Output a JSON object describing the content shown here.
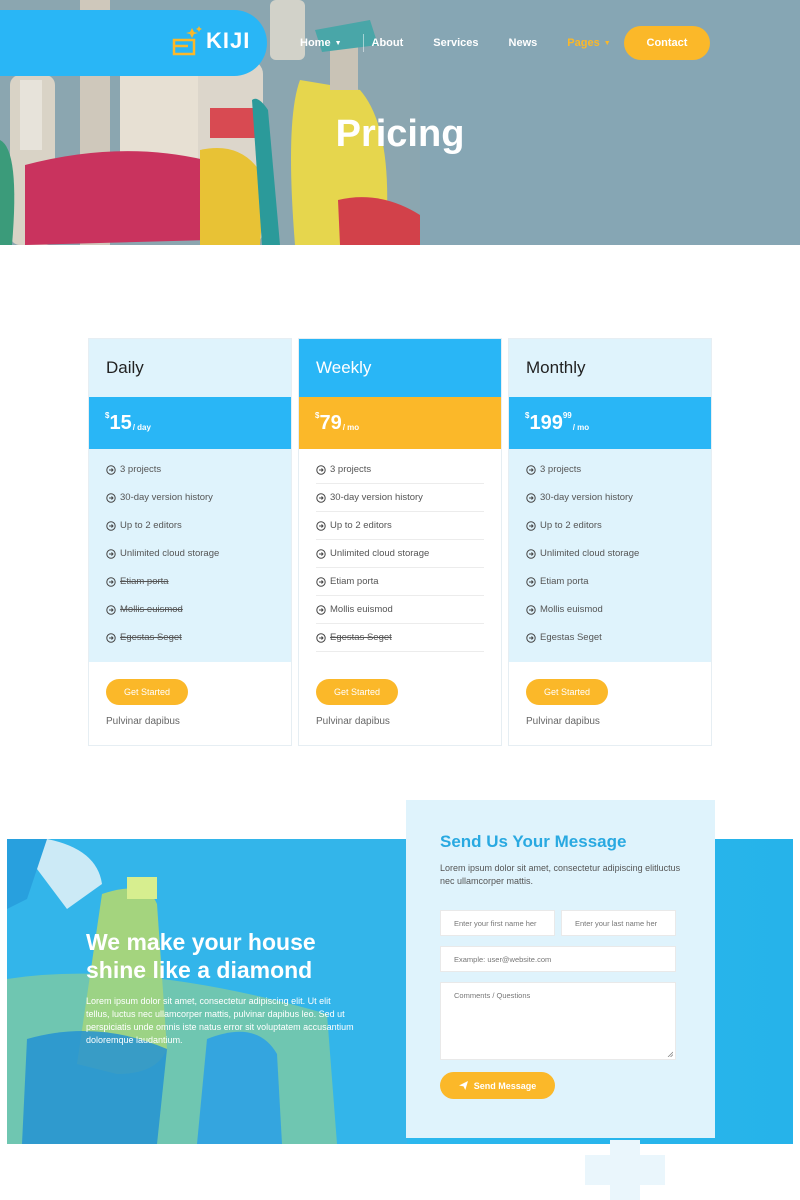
{
  "brand": {
    "name": "KIJI"
  },
  "nav": {
    "items": [
      {
        "label": "Home",
        "has_dropdown": true
      },
      {
        "label": "About"
      },
      {
        "label": "Services"
      },
      {
        "label": "News"
      },
      {
        "label": "Pages",
        "has_dropdown": true,
        "active": true
      }
    ],
    "contact_label": "Contact"
  },
  "hero": {
    "title": "Pricing"
  },
  "plans": [
    {
      "name": "Daily",
      "currency": "$",
      "amount": "15",
      "cents": "",
      "period": "/ day",
      "features": [
        "3 projects",
        "30-day version history",
        "Up to 2 editors",
        "Unlimited cloud storage",
        "Etiam porta",
        "Mollis euismod",
        "Egestas Seget"
      ],
      "struck": [
        false,
        false,
        false,
        false,
        true,
        true,
        true
      ],
      "cta": "Get Started",
      "note": "Pulvinar dapibus"
    },
    {
      "name": "Weekly",
      "currency": "$",
      "amount": "79",
      "cents": "",
      "period": "/ mo",
      "features": [
        "3 projects",
        "30-day version history",
        "Up to 2 editors",
        "Unlimited cloud storage",
        "Etiam porta",
        "Mollis euismod",
        "Egestas Seget"
      ],
      "struck": [
        false,
        false,
        false,
        false,
        false,
        false,
        true
      ],
      "cta": "Get Started",
      "note": "Pulvinar dapibus"
    },
    {
      "name": "Monthly",
      "currency": "$",
      "amount": "199",
      "cents": "99",
      "period": "/ mo",
      "features": [
        "3 projects",
        "30-day version history",
        "Up to 2 editors",
        "Unlimited cloud storage",
        "Etiam porta",
        "Mollis euismod",
        "Egestas Seget"
      ],
      "struck": [
        false,
        false,
        false,
        false,
        false,
        false,
        false
      ],
      "cta": "Get Started",
      "note": "Pulvinar dapibus"
    }
  ],
  "promo": {
    "title": "We make your house shine like a diamond",
    "text": "Lorem ipsum dolor sit amet, consectetur adipiscing elit. Ut elit tellus, luctus nec ullamcorper mattis, pulvinar dapibus leo. Sed ut perspiciatis unde omnis iste natus error sit voluptatem accusantium doloremque laudantium."
  },
  "contact_form": {
    "title": "Send Us Your Message",
    "subtitle": "Lorem ipsum dolor sit amet, consectetur adipiscing elitluctus nec ullamcorper mattis.",
    "first_name_placeholder": "Enter your first name her",
    "last_name_placeholder": "Enter your last name her",
    "email_placeholder": "Example: user@website.com",
    "comments_placeholder": "Comments / Questions",
    "submit_label": "Send Message"
  },
  "colors": {
    "primary": "#29b6f6",
    "accent": "#fbb829",
    "light": "#dff3fc"
  }
}
